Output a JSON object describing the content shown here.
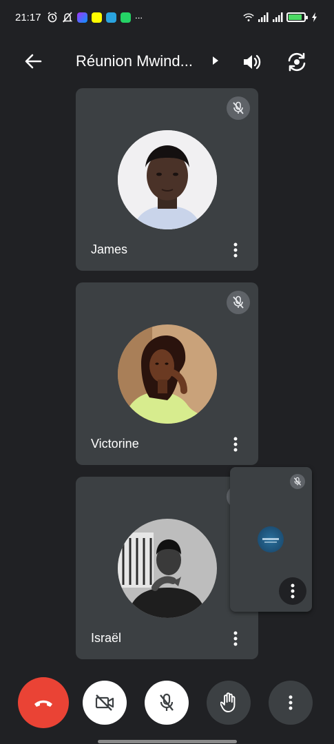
{
  "status_bar": {
    "time": "21:17",
    "notification_icons": [
      "alarm-icon",
      "silent-icon",
      "messenger-icon",
      "snapchat-icon",
      "telegram-icon",
      "whatsapp-icon",
      "more-notifications-icon"
    ],
    "overflow": "···",
    "system_icons": [
      "wifi-icon",
      "signal-icon",
      "signal-2-icon",
      "battery-icon"
    ],
    "battery_level": 0.85
  },
  "header": {
    "title": "Réunion Mwind...",
    "back_icon": "arrow-back-icon",
    "speaker_icon": "speaker-icon",
    "switch_camera_icon": "switch-camera-icon"
  },
  "participants": [
    {
      "name": "James",
      "muted": true
    },
    {
      "name": "Victorine",
      "muted": true
    },
    {
      "name": "Israël",
      "muted": true
    }
  ],
  "self_preview": {
    "muted": true
  },
  "controls": {
    "end_call": "end-call-icon",
    "camera": "camera-off-icon",
    "microphone": "mic-off-icon",
    "raise_hand": "hand-icon",
    "more": "more-vert-icon"
  },
  "colors": {
    "background": "#202124",
    "tile": "#3c4043",
    "end_call": "#ea4335",
    "battery": "#4cd964"
  }
}
